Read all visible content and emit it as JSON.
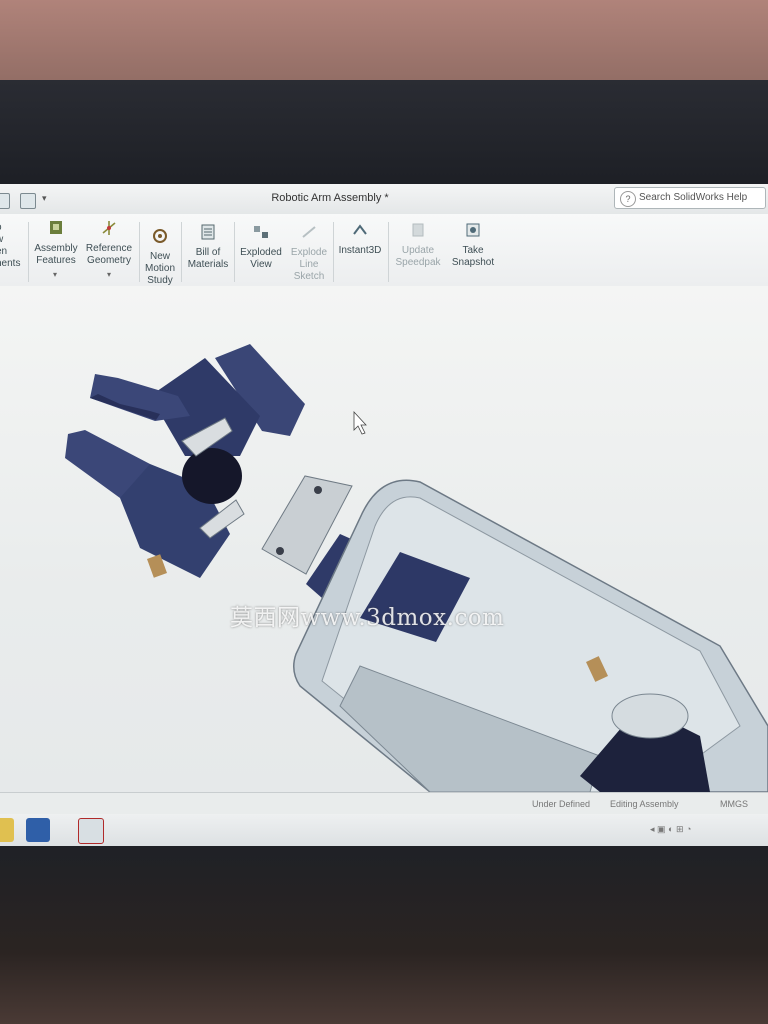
{
  "window": {
    "title": "Robotic Arm Assembly *",
    "help_search_placeholder": "Search SolidWorks Help"
  },
  "ribbon": {
    "partial_left_lines": [
      "o",
      "w",
      "en",
      "nents"
    ],
    "items": [
      {
        "name": "assembly-features",
        "lines": [
          "Assembly",
          "Features"
        ],
        "icon": "assembly-features-icon",
        "enabled": true
      },
      {
        "name": "reference-geometry",
        "lines": [
          "Reference",
          "Geometry"
        ],
        "icon": "reference-geometry-icon",
        "enabled": true
      },
      {
        "name": "new-motion-study",
        "lines": [
          "New",
          "Motion",
          "Study"
        ],
        "icon": "motion-study-icon",
        "enabled": true
      },
      {
        "name": "bill-of-materials",
        "lines": [
          "Bill of",
          "Materials"
        ],
        "icon": "bom-icon",
        "enabled": true
      },
      {
        "name": "exploded-view",
        "lines": [
          "Exploded",
          "View"
        ],
        "icon": "exploded-view-icon",
        "enabled": true
      },
      {
        "name": "explode-line-sketch",
        "lines": [
          "Explode",
          "Line",
          "Sketch"
        ],
        "icon": "explode-line-icon",
        "enabled": false
      },
      {
        "name": "instant3d",
        "lines": [
          "Instant3D"
        ],
        "icon": "instant3d-icon",
        "enabled": true
      },
      {
        "name": "update-speedpak",
        "lines": [
          "Update",
          "Speedpak"
        ],
        "icon": "speedpak-icon",
        "enabled": false
      },
      {
        "name": "take-snapshot",
        "lines": [
          "Take",
          "Snapshot"
        ],
        "icon": "snapshot-icon",
        "enabled": true
      }
    ]
  },
  "status": {
    "state": "Under Defined",
    "mode": "Editing Assembly",
    "units": "MMGS"
  },
  "watermark": "莫西网www.3dmox.com",
  "colors": {
    "part_dark": "#3c4878",
    "part_body": "#c6d0d8",
    "viewport_bg": "#eef0ef"
  }
}
